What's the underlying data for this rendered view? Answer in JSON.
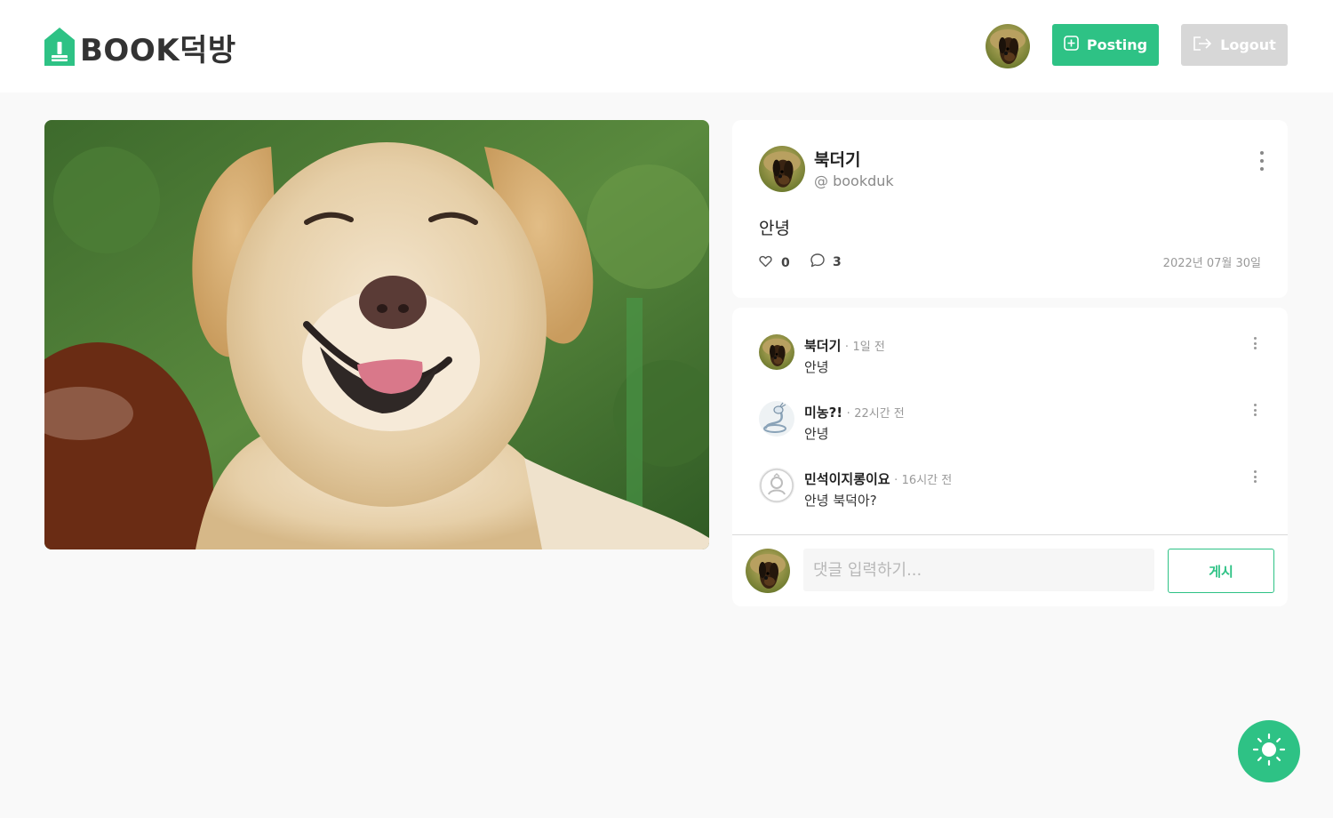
{
  "brand": {
    "logo_text": "BOOK덕방",
    "accent_color": "#2ec285",
    "logo_icon": "house-book-icon"
  },
  "header": {
    "user_avatar": "user-avatar",
    "posting_label": "Posting",
    "posting_icon": "plus-square-icon",
    "logout_label": "Logout",
    "logout_icon": "logout-arrow-icon"
  },
  "post": {
    "image": "smiling-dog-photo",
    "author_name": "북더기",
    "author_id": "@ bookduk",
    "text": "안녕",
    "like_count": "0",
    "comment_count": "3",
    "date": "2022년 07월 30일",
    "like_icon": "heart-icon",
    "comment_icon": "speech-bubble-icon",
    "menu_icon": "more-vertical-icon"
  },
  "comments": [
    {
      "name": "북더기",
      "separator": "·",
      "time": "1일 전",
      "text": "안녕",
      "avatar": "dog-avatar"
    },
    {
      "name": "미농?!",
      "separator": "·",
      "time": "22시간 전",
      "text": "안녕",
      "avatar": "dragon-avatar"
    },
    {
      "name": "민석이지롱이요",
      "separator": "·",
      "time": "16시간 전",
      "text": "안녕 북덕아?",
      "avatar": "default-avatar"
    }
  ],
  "comment_form": {
    "placeholder": "댓글 입력하기...",
    "value": "",
    "submit_label": "게시"
  },
  "theme_toggle": {
    "icon": "sun-icon"
  }
}
